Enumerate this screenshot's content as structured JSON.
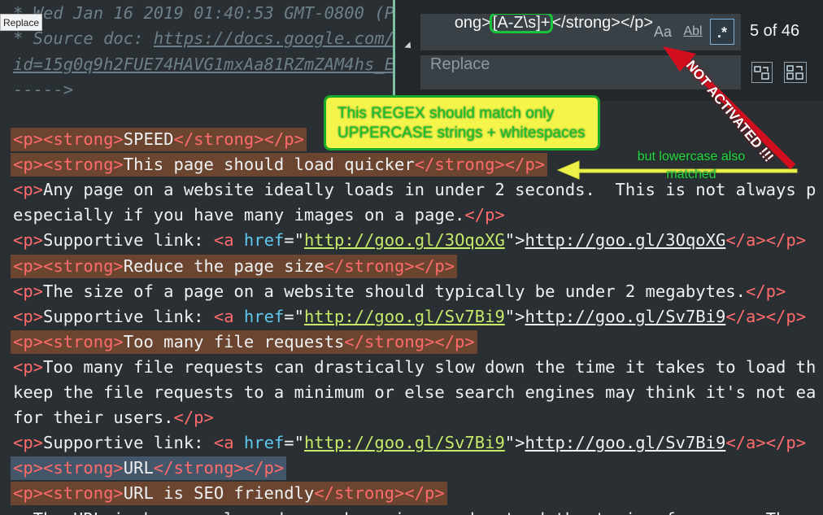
{
  "tooltip": "Replace",
  "editor": {
    "comment": {
      "line1": "* Wed Jan 16 2019 01:40:53 GMT-0800 (P",
      "line2_prefix": "* Source doc: ",
      "line2_url": "https://docs.google.com/",
      "line3": "id=15g0q9h2FUE74HAVG1mxAa81RZmZAM4hs_E",
      "line4": "----->"
    },
    "lines": [
      {
        "kind": "strong",
        "text": "SPEED",
        "highlight": "match"
      },
      {
        "kind": "strong",
        "text": "This page should load quicker",
        "highlight": "match"
      },
      {
        "kind": "p",
        "text": "Any page on a website ideally loads in under 2 seconds.  This is not always p"
      },
      {
        "kind": "p-end",
        "text": "especially if you have many images on a page."
      },
      {
        "kind": "link",
        "label": "Supportive link: ",
        "href": "http://goo.gl/3OqoXG",
        "link_text": "http://goo.gl/3OqoXG"
      },
      {
        "kind": "strong",
        "text": "Reduce the page size",
        "highlight": "match"
      },
      {
        "kind": "p",
        "text": "The size of a page on a website should typically be under 2 megabytes.",
        "closed": true
      },
      {
        "kind": "link",
        "label": "Supportive link: ",
        "href": "http://goo.gl/Sv7Bi9",
        "link_text": "http://goo.gl/Sv7Bi9"
      },
      {
        "kind": "strong",
        "text": "Too many file requests",
        "highlight": "match"
      },
      {
        "kind": "p",
        "text": "Too many file requests can drastically slow down the time it takes to load th"
      },
      {
        "kind": "plain",
        "text": "keep the file requests to a minimum or else search engines may think it's not ea"
      },
      {
        "kind": "p-end",
        "text": "for their users."
      },
      {
        "kind": "link",
        "label": "Supportive link: ",
        "href": "http://goo.gl/Sv7Bi9",
        "link_text": "http://goo.gl/Sv7Bi9"
      },
      {
        "kind": "strong",
        "text": "URL",
        "highlight": "current"
      },
      {
        "kind": "strong",
        "text": "URL is SEO friendly",
        "highlight": "match"
      },
      {
        "kind": "plain",
        "text": "  The URL is how people and search engines understand the topic of a page. The p"
      }
    ]
  },
  "find_panel": {
    "find_value_prefix": "ong>",
    "find_value_regex": "[A-Z\\s]+",
    "find_value_suffix": "</strong></p>",
    "option_case_label": "Aa",
    "option_word_label": "Abl",
    "option_regex_label": ".*",
    "match_count": "5 of 46",
    "replace_placeholder": "Replace"
  },
  "annotations": {
    "callout_lines": [
      "This REGEX should match only",
      "UPPERCASE strings + whitespaces"
    ],
    "lowercase_note": "but lowercase also matched",
    "not_activated": "NOT ACTIVATED !!!"
  },
  "colors": {
    "editor_bg": "#2a2f33",
    "match_highlight": "#6b4530",
    "current_highlight": "#44576a",
    "tag": "#ff6b6b",
    "attr": "#61c8ee",
    "string": "#c6e96a",
    "callout_bg": "#f4f44a",
    "regex_outline": "#17c43a",
    "arrow_red": "#d10f1f"
  }
}
